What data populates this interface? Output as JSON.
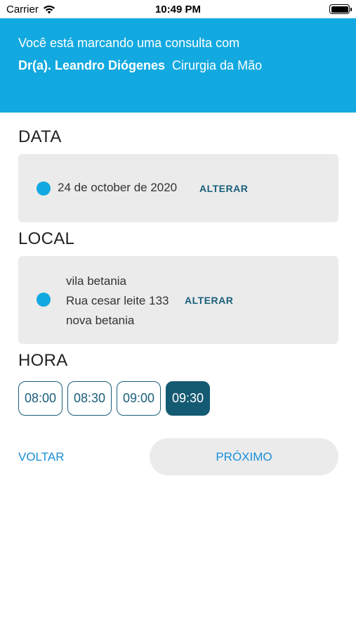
{
  "status_bar": {
    "carrier": "Carrier",
    "time": "10:49 PM"
  },
  "header": {
    "intro": "Você está marcando uma consulta com",
    "doctor": "Dr(a). Leandro Diógenes",
    "specialty": "Cirurgia da Mão",
    "background_color": "#12a9e0"
  },
  "date_section": {
    "title": "DATA",
    "value": "24 de october de 2020",
    "change_label": "ALTERAR"
  },
  "location_section": {
    "title": "LOCAL",
    "lines": [
      "vila betania",
      "Rua cesar leite 133",
      "nova betania"
    ],
    "change_label": "ALTERAR"
  },
  "time_section": {
    "title": "HORA",
    "slots": [
      "08:00",
      "08:30",
      "09:00",
      "09:30"
    ],
    "selected": "09:30"
  },
  "actions": {
    "back_label": "VOLTAR",
    "next_label": "PRÓXIMO"
  }
}
